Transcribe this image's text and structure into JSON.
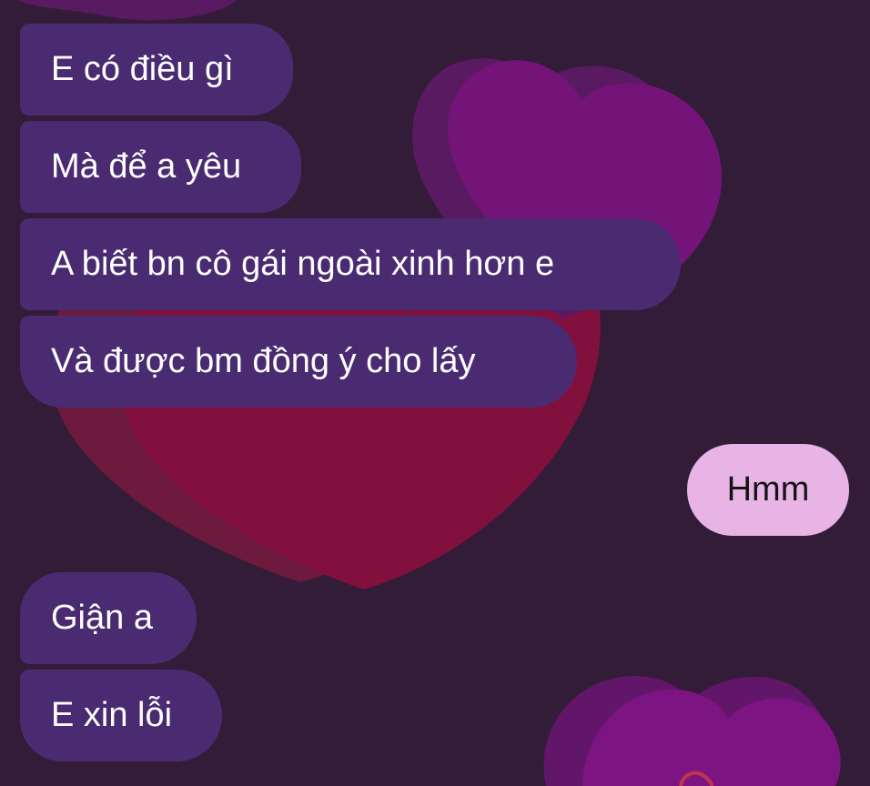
{
  "theme": {
    "background": "#331c38",
    "incoming_bubble": "#4a2b72",
    "outgoing_bubble": "#e8b4e6",
    "incoming_text": "#ffffff",
    "outgoing_text": "#141414"
  },
  "messages": [
    {
      "direction": "incoming",
      "text": "E có điều gì"
    },
    {
      "direction": "incoming",
      "text": "Mà để a yêu"
    },
    {
      "direction": "incoming",
      "text": "A biết  bn cô gái ngoài xinh hơn e"
    },
    {
      "direction": "incoming",
      "text": "Và được bm đồng ý cho lấy"
    },
    {
      "direction": "outgoing",
      "text": "Hmm"
    },
    {
      "direction": "incoming",
      "text": "Giận a"
    },
    {
      "direction": "incoming",
      "text": "E xin lỗi"
    }
  ]
}
